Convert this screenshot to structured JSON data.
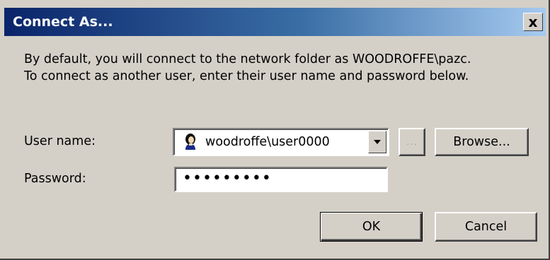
{
  "window": {
    "title": "Connect As...",
    "close_label": "x"
  },
  "description": "By default, you will connect to the network folder as WOODROFFE\\pazc. To connect as another user, enter their user name and password below.",
  "user_name": {
    "label": "User name:",
    "value": "woodroffe\\user0000",
    "icon": "user-icon"
  },
  "ellipsis_button": {
    "label": "..."
  },
  "browse_button": {
    "label": "Browse..."
  },
  "password": {
    "label": "Password:",
    "value": "•••••••••"
  },
  "ok_button": {
    "label": "OK"
  },
  "cancel_button": {
    "label": "Cancel"
  },
  "colors": {
    "title_gradient_start": "#0a246a",
    "title_gradient_end": "#a6caf0",
    "dialog_face": "#d4d0c8"
  }
}
